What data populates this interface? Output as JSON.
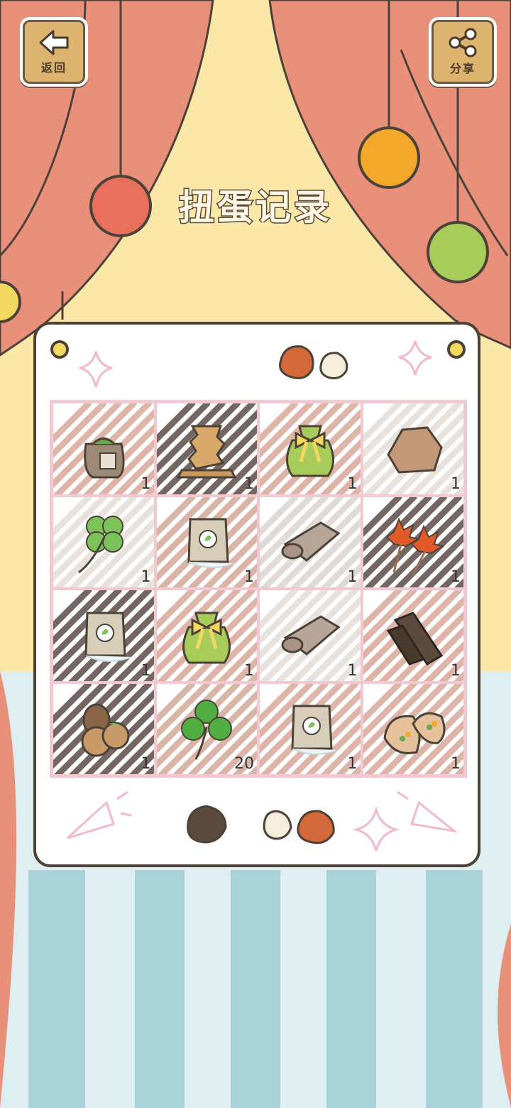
{
  "header": {
    "back_label": "返回",
    "share_label": "分享",
    "title": "扭蛋记录"
  },
  "colors": {
    "curtain": "#e8907a",
    "backdrop": "#fbe8a8",
    "stripe_light": "#dfeef1",
    "stripe_dark": "#a9d3d8",
    "grid_line": "#f2c9d0",
    "panel_border": "#4c4238"
  },
  "items": [
    {
      "name": "seed-sack",
      "icon": "seed-sack-icon",
      "count": "1"
    },
    {
      "name": "stacked-wooden-tower",
      "icon": "wood-stack-icon",
      "count": "1"
    },
    {
      "name": "green-striped-gift-bag",
      "icon": "gift-bag-icon",
      "count": "1"
    },
    {
      "name": "brown-rock",
      "icon": "rock-icon",
      "count": "1"
    },
    {
      "name": "four-leaf-clover",
      "icon": "four-leaf-clover-icon",
      "count": "1"
    },
    {
      "name": "seed-packet-white",
      "icon": "seed-packet-icon",
      "count": "1"
    },
    {
      "name": "rolled-cloth",
      "icon": "rolled-cloth-icon",
      "count": "1"
    },
    {
      "name": "maple-leaves",
      "icon": "maple-leaf-icon",
      "count": "1"
    },
    {
      "name": "seed-packet-blue",
      "icon": "seed-packet-icon",
      "count": "1"
    },
    {
      "name": "green-striped-gift-bag",
      "icon": "gift-bag-icon",
      "count": "1"
    },
    {
      "name": "rolled-cloth",
      "icon": "rolled-cloth-icon",
      "count": "1"
    },
    {
      "name": "bark-pieces",
      "icon": "bark-icon",
      "count": "1"
    },
    {
      "name": "pinecone-and-nuts",
      "icon": "pinecone-icon",
      "count": "1"
    },
    {
      "name": "three-leaf-clover",
      "icon": "clover-icon",
      "count": "20"
    },
    {
      "name": "seed-packet-white",
      "icon": "seed-packet-icon",
      "count": "1"
    },
    {
      "name": "stuffed-buns",
      "icon": "bun-icon",
      "count": "1"
    }
  ]
}
